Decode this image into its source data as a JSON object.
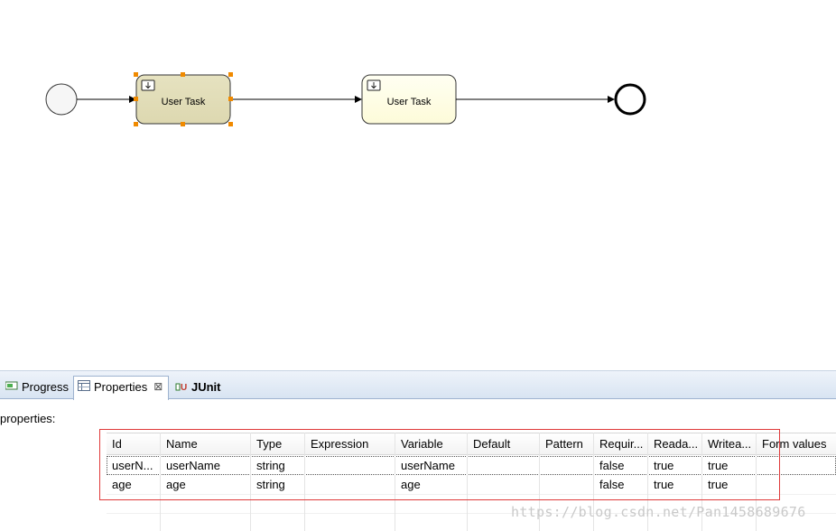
{
  "diagram": {
    "task1_label": "User Task",
    "task2_label": "User Task"
  },
  "tabs": [
    {
      "label": "Progress",
      "icon": "progress-icon"
    },
    {
      "label": "Properties",
      "icon": "properties-icon",
      "close": "⊠"
    },
    {
      "label": "JUnit",
      "icon": "junit-icon"
    }
  ],
  "properties_label": "properties:",
  "table": {
    "columns": [
      "Id",
      "Name",
      "Type",
      "Expression",
      "Variable",
      "Default",
      "Pattern",
      "Requir...",
      "Reada...",
      "Writea...",
      "Form values"
    ],
    "rows": [
      [
        "userN...",
        "userName",
        "string",
        "",
        "userName",
        "",
        "",
        "false",
        "true",
        "true",
        ""
      ],
      [
        "age",
        "age",
        "string",
        "",
        "age",
        "",
        "",
        "false",
        "true",
        "true",
        ""
      ]
    ]
  },
  "watermark": "https://blog.csdn.net/Pan1458689676"
}
